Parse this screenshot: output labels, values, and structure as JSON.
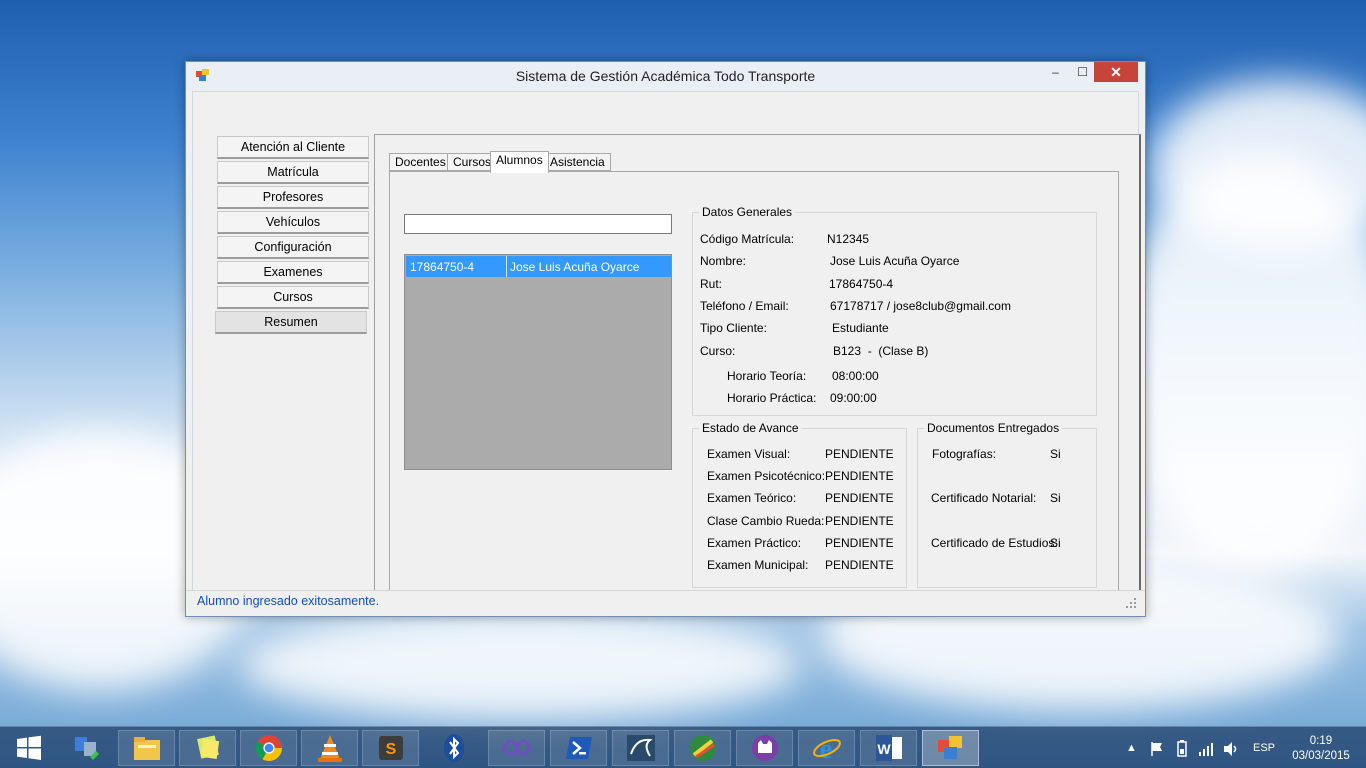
{
  "window": {
    "title": "Sistema de Gestión Académica Todo Transporte",
    "close": "✕",
    "minimize": "–",
    "maximize": "☐"
  },
  "menu": [
    {
      "label": "Atención al Cliente"
    },
    {
      "label": "Matrícula"
    },
    {
      "label": "Profesores"
    },
    {
      "label": "Vehículos"
    },
    {
      "label": "Configuración"
    },
    {
      "label": "Examenes"
    },
    {
      "label": "Cursos"
    },
    {
      "label": "Resumen"
    }
  ],
  "tabs": [
    {
      "label": "Docentes"
    },
    {
      "label": "Cursos"
    },
    {
      "label": "Alumnos"
    },
    {
      "label": "Asistencia"
    }
  ],
  "search": {
    "value": ""
  },
  "list": {
    "rows": [
      {
        "rut": "17864750-4",
        "name": "Jose Luis Acuña Oyarce"
      }
    ]
  },
  "datos": {
    "title": "Datos Generales",
    "codigo_label": "Código Matrícula:",
    "codigo": "N12345",
    "nombre_label": "Nombre:",
    "nombre": "Jose Luis Acuña Oyarce",
    "rut_label": "Rut:",
    "rut": "17864750-4",
    "tel_label": "Teléfono / Email:",
    "tel": "67178717 / jose8club@gmail.com",
    "tipo_label": "Tipo Cliente:",
    "tipo": "Estudiante",
    "curso_label": "Curso:",
    "curso": "B123  -  (Clase B)",
    "teoria_label": "Horario Teoría:",
    "teoria": "08:00:00",
    "practica_label": "Horario Práctica:",
    "practica": "09:00:00"
  },
  "avance": {
    "title": "Estado de Avance",
    "items": [
      {
        "label": "Examen Visual:",
        "value": "PENDIENTE"
      },
      {
        "label": "Examen Psicotécnico:",
        "value": "PENDIENTE"
      },
      {
        "label": "Examen Teórico:",
        "value": "PENDIENTE"
      },
      {
        "label": "Clase Cambio Rueda:",
        "value": "PENDIENTE"
      },
      {
        "label": "Examen Práctico:",
        "value": "PENDIENTE"
      },
      {
        "label": "Examen Municipal:",
        "value": "PENDIENTE"
      }
    ]
  },
  "documentos": {
    "title": "Documentos Entregados",
    "items": [
      {
        "label": "Fotografías:",
        "value": "Si"
      },
      {
        "label": "Certificado Notarial:",
        "value": "Si"
      },
      {
        "label": "Certificado de Estudios:",
        "value": "Si"
      }
    ]
  },
  "status": {
    "text": "Alumno ingresado exitosamente."
  },
  "taskbar": {
    "apps": [
      "start-icon",
      "desktop-manager-icon",
      "file-explorer-icon",
      "sticky-notes-icon",
      "chrome-icon",
      "vlc-icon",
      "sublime-text-icon",
      "bluetooth-icon",
      "visual-studio-icon",
      "powershell-icon",
      "mysql-workbench-icon",
      "pidgin-icon",
      "github-icon",
      "internet-explorer-icon",
      "word-icon",
      "app-icon"
    ],
    "lang": "ESP",
    "time": "0:19",
    "date": "03/03/2015"
  },
  "colors": {
    "selection": "#3399ff",
    "status_text": "#0f4fb5",
    "close_button": "#c7443b"
  }
}
